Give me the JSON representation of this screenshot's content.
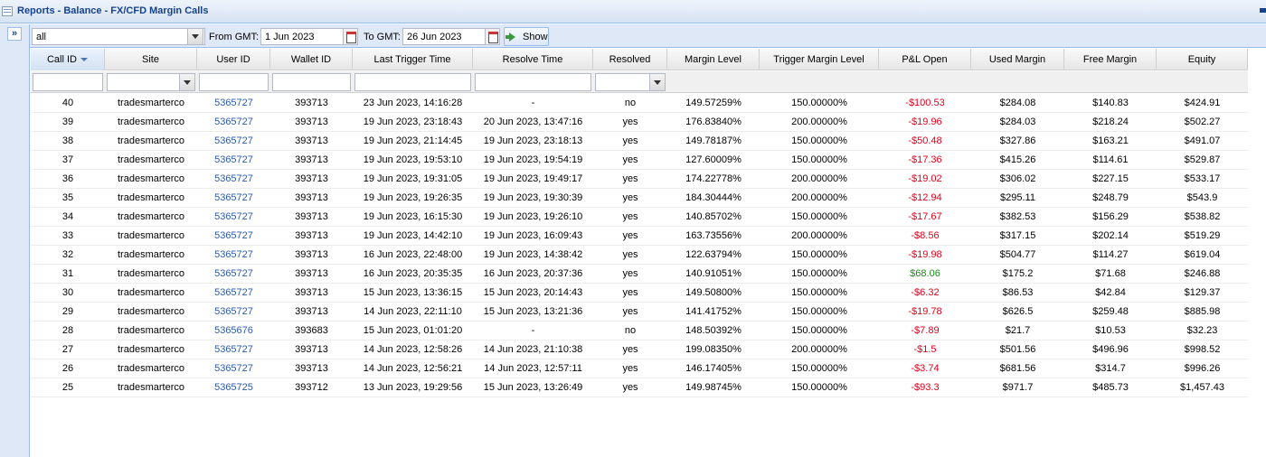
{
  "window": {
    "title": "Reports - Balance - FX/CFD Margin Calls"
  },
  "toolbar": {
    "site_select": "all",
    "from_label": "From GMT:",
    "from_date": "1 Jun 2023",
    "to_label": "To GMT:",
    "to_date": "26 Jun 2023",
    "show_label": "Show"
  },
  "columns": [
    "Call ID",
    "Site",
    "User ID",
    "Wallet ID",
    "Last Trigger Time",
    "Resolve Time",
    "Resolved",
    "Margin Level",
    "Trigger Margin Level",
    "P&L Open",
    "Used Margin",
    "Free Margin",
    "Equity"
  ],
  "sorted_column": "Call ID",
  "rows": [
    [
      "40",
      "tradesmarterco",
      "5365727",
      "393713",
      "23 Jun 2023, 14:16:28",
      "-",
      "no",
      "149.57259%",
      "150.00000%",
      "-$100.53",
      "$284.08",
      "$140.83",
      "$424.91"
    ],
    [
      "39",
      "tradesmarterco",
      "5365727",
      "393713",
      "19 Jun 2023, 23:18:43",
      "20 Jun 2023, 13:47:16",
      "yes",
      "176.83840%",
      "200.00000%",
      "-$19.96",
      "$284.03",
      "$218.24",
      "$502.27"
    ],
    [
      "38",
      "tradesmarterco",
      "5365727",
      "393713",
      "19 Jun 2023, 21:14:45",
      "19 Jun 2023, 23:18:13",
      "yes",
      "149.78187%",
      "150.00000%",
      "-$50.48",
      "$327.86",
      "$163.21",
      "$491.07"
    ],
    [
      "37",
      "tradesmarterco",
      "5365727",
      "393713",
      "19 Jun 2023, 19:53:10",
      "19 Jun 2023, 19:54:19",
      "yes",
      "127.60009%",
      "150.00000%",
      "-$17.36",
      "$415.26",
      "$114.61",
      "$529.87"
    ],
    [
      "36",
      "tradesmarterco",
      "5365727",
      "393713",
      "19 Jun 2023, 19:31:05",
      "19 Jun 2023, 19:49:17",
      "yes",
      "174.22778%",
      "200.00000%",
      "-$19.02",
      "$306.02",
      "$227.15",
      "$533.17"
    ],
    [
      "35",
      "tradesmarterco",
      "5365727",
      "393713",
      "19 Jun 2023, 19:26:35",
      "19 Jun 2023, 19:30:39",
      "yes",
      "184.30444%",
      "200.00000%",
      "-$12.94",
      "$295.11",
      "$248.79",
      "$543.9"
    ],
    [
      "34",
      "tradesmarterco",
      "5365727",
      "393713",
      "19 Jun 2023, 16:15:30",
      "19 Jun 2023, 19:26:10",
      "yes",
      "140.85702%",
      "150.00000%",
      "-$17.67",
      "$382.53",
      "$156.29",
      "$538.82"
    ],
    [
      "33",
      "tradesmarterco",
      "5365727",
      "393713",
      "19 Jun 2023, 14:42:10",
      "19 Jun 2023, 16:09:43",
      "yes",
      "163.73556%",
      "200.00000%",
      "-$8.56",
      "$317.15",
      "$202.14",
      "$519.29"
    ],
    [
      "32",
      "tradesmarterco",
      "5365727",
      "393713",
      "16 Jun 2023, 22:48:00",
      "19 Jun 2023, 14:38:42",
      "yes",
      "122.63794%",
      "150.00000%",
      "-$19.98",
      "$504.77",
      "$114.27",
      "$619.04"
    ],
    [
      "31",
      "tradesmarterco",
      "5365727",
      "393713",
      "16 Jun 2023, 20:35:35",
      "16 Jun 2023, 20:37:36",
      "yes",
      "140.91051%",
      "150.00000%",
      "$68.06",
      "$175.2",
      "$71.68",
      "$246.88"
    ],
    [
      "30",
      "tradesmarterco",
      "5365727",
      "393713",
      "15 Jun 2023, 13:36:15",
      "15 Jun 2023, 20:14:43",
      "yes",
      "149.50800%",
      "150.00000%",
      "-$6.32",
      "$86.53",
      "$42.84",
      "$129.37"
    ],
    [
      "29",
      "tradesmarterco",
      "5365727",
      "393713",
      "14 Jun 2023, 22:11:10",
      "15 Jun 2023, 13:21:36",
      "yes",
      "141.41752%",
      "150.00000%",
      "-$19.78",
      "$626.5",
      "$259.48",
      "$885.98"
    ],
    [
      "28",
      "tradesmarterco",
      "5365676",
      "393683",
      "15 Jun 2023, 01:01:20",
      "-",
      "no",
      "148.50392%",
      "150.00000%",
      "-$7.89",
      "$21.7",
      "$10.53",
      "$32.23"
    ],
    [
      "27",
      "tradesmarterco",
      "5365727",
      "393713",
      "14 Jun 2023, 12:58:26",
      "14 Jun 2023, 21:10:38",
      "yes",
      "199.08350%",
      "200.00000%",
      "-$1.5",
      "$501.56",
      "$496.96",
      "$998.52"
    ],
    [
      "26",
      "tradesmarterco",
      "5365727",
      "393713",
      "14 Jun 2023, 12:56:21",
      "14 Jun 2023, 12:57:11",
      "yes",
      "146.17405%",
      "150.00000%",
      "-$3.74",
      "$681.56",
      "$314.7",
      "$996.26"
    ],
    [
      "25",
      "tradesmarterco",
      "5365725",
      "393712",
      "13 Jun 2023, 19:29:56",
      "15 Jun 2023, 13:26:49",
      "yes",
      "149.98745%",
      "150.00000%",
      "-$93.3",
      "$971.7",
      "$485.73",
      "$1,457.43"
    ]
  ],
  "colors": {
    "negative": "#e2001a",
    "positive": "#1a8a1a",
    "link": "#2e5aa8",
    "header_text": "#15428b"
  }
}
